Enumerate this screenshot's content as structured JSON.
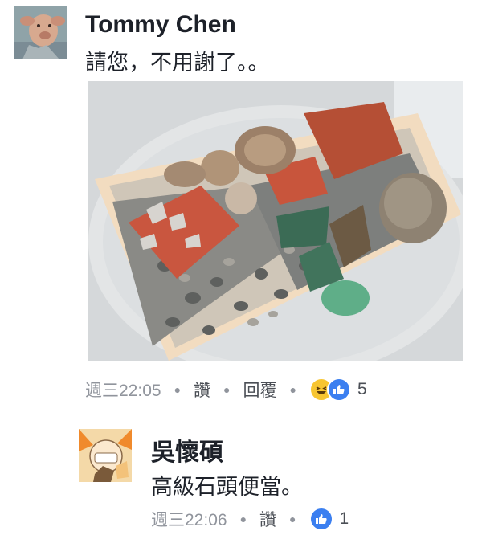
{
  "comments": [
    {
      "author": "Tommy Chen",
      "text": "請您，不用謝了。。",
      "time": "週三22:05",
      "like_label": "讚",
      "reply_label": "回覆",
      "reaction_count": "5",
      "reaction_icons": [
        "haha-icon",
        "like-icon"
      ]
    },
    {
      "author": "吳懷碩",
      "text": "高級石頭便當。",
      "time": "週三22:06",
      "like_label": "讚",
      "reaction_count": "1",
      "reaction_icons": [
        "like-icon"
      ]
    }
  ],
  "colors": {
    "name": "#1d2129",
    "meta": "#90949c",
    "like_blue": "#3b7ff0",
    "haha_yellow": "#f7c531"
  }
}
